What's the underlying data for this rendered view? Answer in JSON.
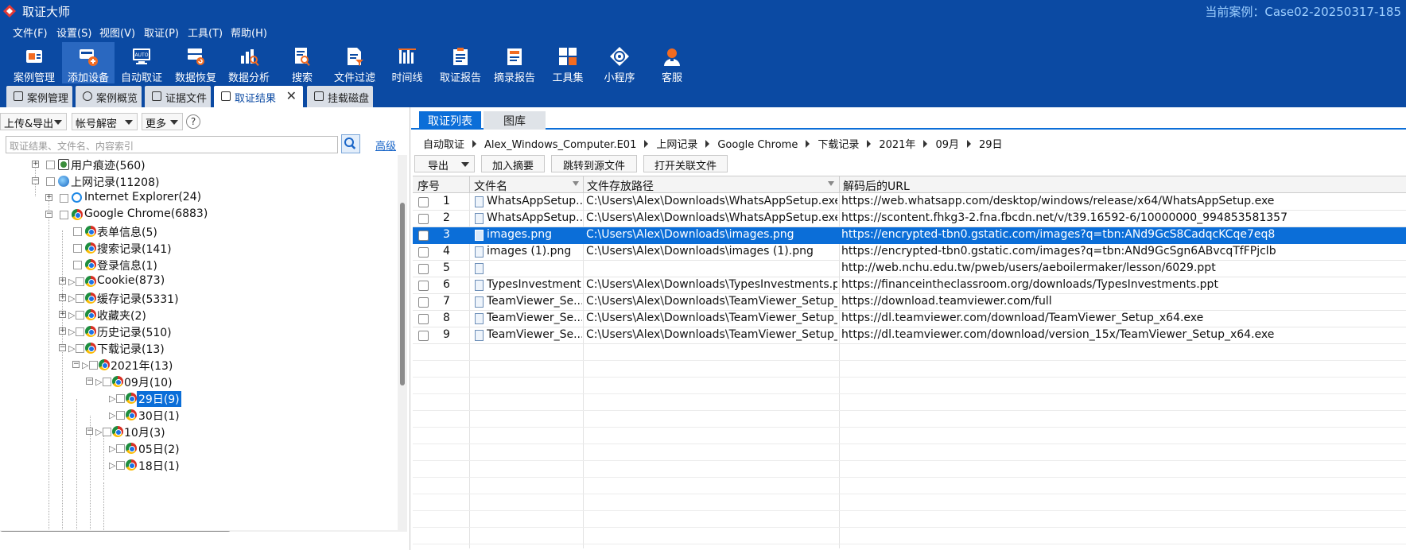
{
  "app": {
    "title": "取证大师",
    "current_case": "当前案例：Case02-20250317-185"
  },
  "menu": [
    "文件(F)",
    "设置(S)",
    "视图(V)",
    "取证(P)",
    "工具(T)",
    "帮助(H)"
  ],
  "toolbar": [
    {
      "label": "案例管理",
      "icon": "case-management-icon"
    },
    {
      "label": "添加设备",
      "icon": "add-device-icon"
    },
    {
      "label": "自动取证",
      "icon": "auto-forensics-icon"
    },
    {
      "label": "数据恢复",
      "icon": "data-recovery-icon"
    },
    {
      "label": "数据分析",
      "icon": "data-analysis-icon"
    },
    {
      "label": "搜索",
      "icon": "search-icon"
    },
    {
      "label": "文件过滤",
      "icon": "file-filter-icon"
    },
    {
      "label": "时间线",
      "icon": "timeline-icon"
    },
    {
      "label": "取证报告",
      "icon": "forensics-report-icon"
    },
    {
      "label": "摘录报告",
      "icon": "excerpt-report-icon"
    },
    {
      "label": "工具集",
      "icon": "toolset-icon"
    },
    {
      "label": "小程序",
      "icon": "mini-program-icon"
    },
    {
      "label": "客服",
      "icon": "customer-service-icon"
    }
  ],
  "doc_tabs": [
    "案例管理",
    "案例概览",
    "证据文件",
    "取证结果",
    "挂载磁盘"
  ],
  "left": {
    "upload_export": "上传&导出",
    "account_decrypt": "帐号解密",
    "more": "更多",
    "help": "?",
    "search_placeholder": "取证结果、文件名、内容索引",
    "advanced": "高级",
    "tree": [
      {
        "label": "用户痕迹(560)"
      },
      {
        "label": "上网记录(11208)"
      },
      {
        "label": "Internet Explorer(24)"
      },
      {
        "label": "Google Chrome(6883)"
      },
      {
        "label": "表单信息(5)"
      },
      {
        "label": "搜索记录(141)"
      },
      {
        "label": "登录信息(1)"
      },
      {
        "label": "Cookie(873)"
      },
      {
        "label": "缓存记录(5331)"
      },
      {
        "label": "收藏夹(2)"
      },
      {
        "label": "历史记录(510)"
      },
      {
        "label": "下载记录(13)"
      },
      {
        "label": "2021年(13)"
      },
      {
        "label": "09月(10)"
      },
      {
        "label": "29日(9)"
      },
      {
        "label": "30日(1)"
      },
      {
        "label": "10月(3)"
      },
      {
        "label": "05日(2)"
      },
      {
        "label": "18日(1)"
      }
    ]
  },
  "right": {
    "tabs": [
      "取证列表",
      "图库"
    ],
    "breadcrumb": [
      "自动取证",
      "Alex_Windows_Computer.E01",
      "上网记录",
      "Google Chrome",
      "下载记录",
      "2021年",
      "09月",
      "29日"
    ],
    "actions": {
      "export": "导出",
      "add_excerpt": "加入摘要",
      "jump_source": "跳转到源文件",
      "open_related": "打开关联文件"
    },
    "columns": [
      "序号",
      "文件名",
      "文件存放路径",
      "解码后的URL"
    ],
    "rows": [
      {
        "no": "1",
        "name": "WhatsAppSetup....",
        "path": "C:\\Users\\Alex\\Downloads\\WhatsAppSetup.exe",
        "url": "https://web.whatsapp.com/desktop/windows/release/x64/WhatsAppSetup.exe"
      },
      {
        "no": "2",
        "name": "WhatsAppSetup....",
        "path": "C:\\Users\\Alex\\Downloads\\WhatsAppSetup.exe",
        "url": "https://scontent.fhkg3-2.fna.fbcdn.net/v/t39.16592-6/10000000_994853581357"
      },
      {
        "no": "3",
        "name": "images.png",
        "path": "C:\\Users\\Alex\\Downloads\\images.png",
        "url": "https://encrypted-tbn0.gstatic.com/images?q=tbn:ANd9GcS8CadqcKCqe7eq8"
      },
      {
        "no": "4",
        "name": "images (1).png",
        "path": "C:\\Users\\Alex\\Downloads\\images (1).png",
        "url": "https://encrypted-tbn0.gstatic.com/images?q=tbn:ANd9GcSgn6ABvcqTfFPjclb"
      },
      {
        "no": "5",
        "name": "",
        "path": "",
        "url": "http://web.nchu.edu.tw/pweb/users/aeboilermaker/lesson/6029.ppt"
      },
      {
        "no": "6",
        "name": "TypesInvestment...",
        "path": "C:\\Users\\Alex\\Downloads\\TypesInvestments.ppt",
        "url": "https://financeintheclassroom.org/downloads/TypesInvestments.ppt"
      },
      {
        "no": "7",
        "name": "TeamViewer_Se...",
        "path": "C:\\Users\\Alex\\Downloads\\TeamViewer_Setup_...",
        "url": "https://download.teamviewer.com/full"
      },
      {
        "no": "8",
        "name": "TeamViewer_Se...",
        "path": "C:\\Users\\Alex\\Downloads\\TeamViewer_Setup_...",
        "url": "https://dl.teamviewer.com/download/TeamViewer_Setup_x64.exe"
      },
      {
        "no": "9",
        "name": "TeamViewer_Se...",
        "path": "C:\\Users\\Alex\\Downloads\\TeamViewer_Setup_...",
        "url": "https://dl.teamviewer.com/download/version_15x/TeamViewer_Setup_x64.exe"
      }
    ],
    "selected_row": 3
  },
  "colors": {
    "brand_blue": "#0b4aa3",
    "selection_blue": "#0b6ed8",
    "case_text": "#9fd0ff"
  }
}
